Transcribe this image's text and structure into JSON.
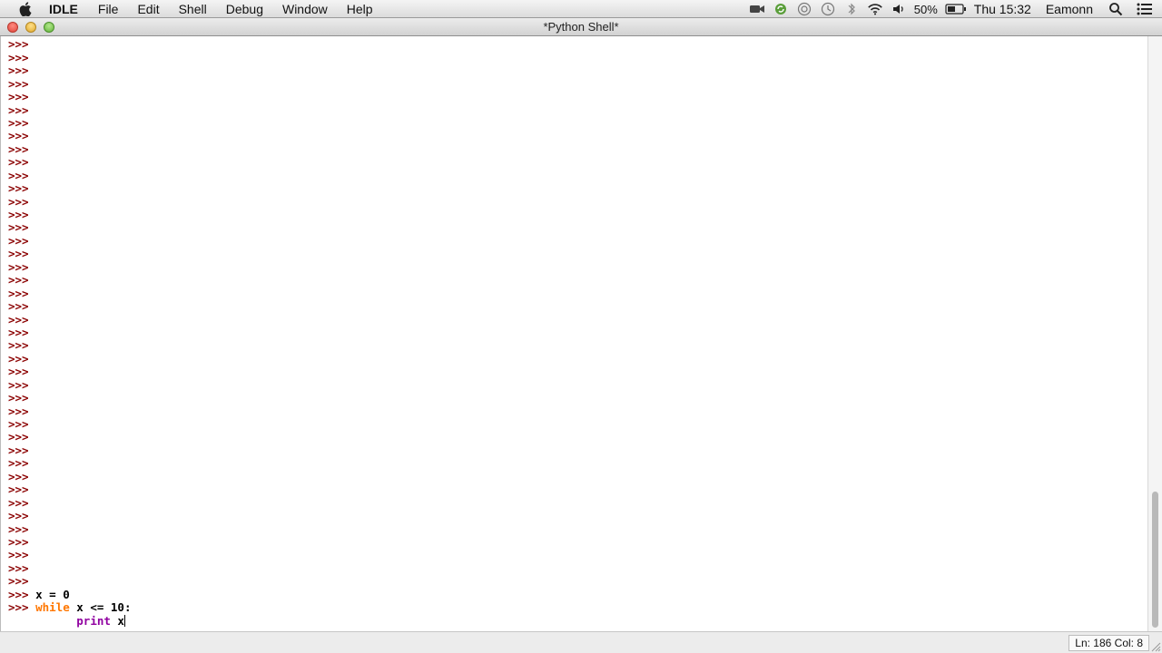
{
  "menubar": {
    "app_name": "IDLE",
    "items": [
      {
        "label": "File"
      },
      {
        "label": "Edit"
      },
      {
        "label": "Shell"
      },
      {
        "label": "Debug"
      },
      {
        "label": "Window"
      },
      {
        "label": "Help"
      }
    ],
    "battery_percent": "50%",
    "clock": "Thu 15:32",
    "user": "Eamonn",
    "tray_icons": [
      "facetime-camera-icon",
      "sync-icon",
      "screen-share-icon",
      "time-machine-icon",
      "bluetooth-icon",
      "wifi-icon",
      "volume-icon",
      "battery-icon",
      "spotlight-search-icon",
      "notification-center-icon"
    ]
  },
  "window": {
    "title": "*Python Shell*"
  },
  "shell": {
    "prompt": ">>>",
    "empty_prompt_count": 42,
    "code_lines": [
      {
        "prompt": ">>>",
        "indent": "",
        "tokens": [
          {
            "text": "x = 0",
            "style": "plain"
          }
        ]
      },
      {
        "prompt": ">>>",
        "indent": "",
        "tokens": [
          {
            "text": "while",
            "style": "keyword"
          },
          {
            "text": " x <= 10:",
            "style": "plain"
          }
        ]
      },
      {
        "prompt": "",
        "indent": "\t",
        "tokens": [
          {
            "text": "print",
            "style": "builtin"
          },
          {
            "text": " x",
            "style": "plain"
          }
        ]
      }
    ]
  },
  "statusbar": {
    "position": "Ln: 186 Col: 8"
  },
  "colors": {
    "prompt": "#8b0000",
    "keyword": "#ff7700",
    "builtin": "#9000a0",
    "plain": "#000000"
  }
}
